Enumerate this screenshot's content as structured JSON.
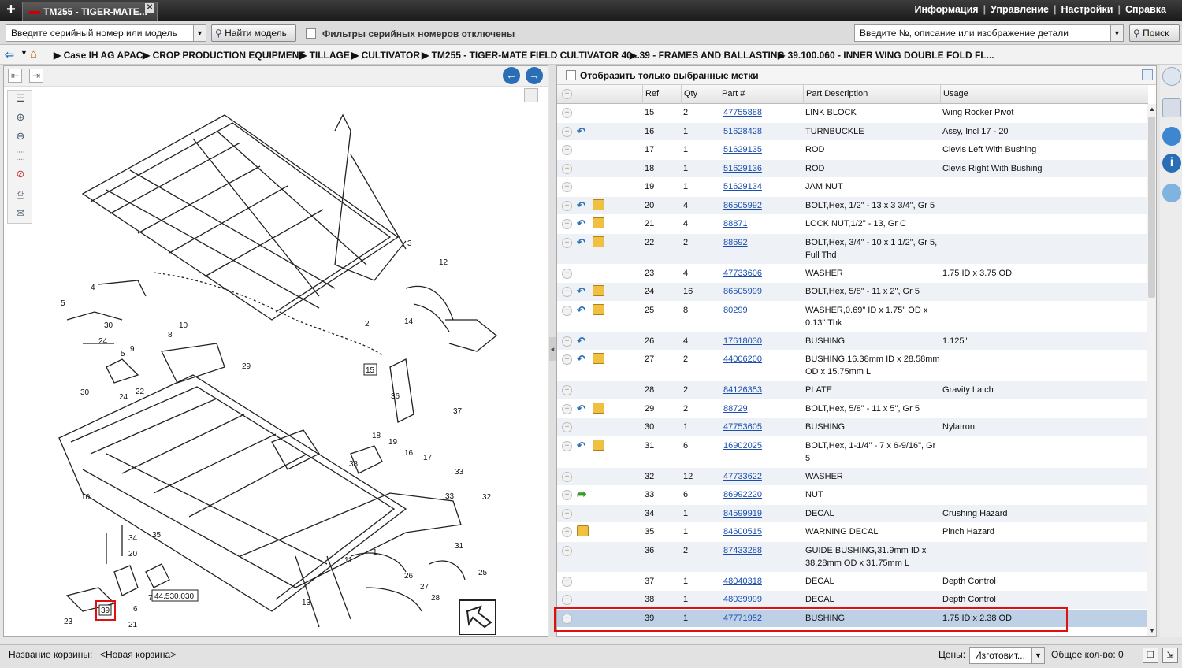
{
  "tab": {
    "title": "TM255 - TIGER-MATE..."
  },
  "top_menu": [
    "Информация",
    "Управление",
    "Настройки",
    "Справка"
  ],
  "toolbar": {
    "serial_placeholder": "Введите серийный номер или модель",
    "find_model_label": "Найти модель",
    "serial_filter_label": "Фильтры серийных номеров отключены",
    "part_search_placeholder": "Введите №, описание или изображение детали",
    "search_label": "Поиск"
  },
  "breadcrumbs": [
    "Case IH AG APAC",
    "CROP PRODUCTION EQUIPMENT",
    "TILLAGE",
    "CULTIVATOR",
    "TM255 - TIGER-MATE FIELD CULTIVATOR 40...",
    "39 - FRAMES AND BALLASTING",
    "39.100.060 - INNER WING DOUBLE FOLD FL..."
  ],
  "diagram": {
    "callouts": [
      "1",
      "2",
      "3",
      "4",
      "5",
      "7",
      "8",
      "9",
      "10",
      "11",
      "12",
      "13",
      "14",
      "15",
      "16",
      "17",
      "18",
      "19",
      "20",
      "21",
      "22",
      "23",
      "24",
      "25",
      "26",
      "27",
      "28",
      "29",
      "30",
      "31",
      "32",
      "33",
      "34",
      "35",
      "36",
      "37",
      "38",
      "39"
    ],
    "selected_callout": "39",
    "image_ref_label": "44.530.030"
  },
  "parts_table": {
    "show_selected_label": "Отобразить только выбранные метки",
    "columns": [
      "Ref",
      "Qty",
      "Part #",
      "Part Description",
      "Usage"
    ],
    "rows": [
      {
        "ref": "15",
        "qty": "2",
        "part": "47755888",
        "desc": "LINK BLOCK",
        "usage": "Wing Rocker Pivot",
        "icons": []
      },
      {
        "ref": "16",
        "qty": "1",
        "part": "51628428",
        "desc": "TURNBUCKLE",
        "usage": "Assy, Incl 17 - 20",
        "icons": [
          "arrow"
        ]
      },
      {
        "ref": "17",
        "qty": "1",
        "part": "51629135",
        "desc": "ROD",
        "usage": "Clevis Left With Bushing",
        "icons": []
      },
      {
        "ref": "18",
        "qty": "1",
        "part": "51629136",
        "desc": "ROD",
        "usage": "Clevis Right With Bushing",
        "icons": []
      },
      {
        "ref": "19",
        "qty": "1",
        "part": "51629134",
        "desc": "JAM NUT",
        "usage": "",
        "icons": []
      },
      {
        "ref": "20",
        "qty": "4",
        "part": "86505992",
        "desc": "BOLT,Hex, 1/2\" - 13 x 3 3/4\", Gr 5",
        "usage": "",
        "icons": [
          "arrow",
          "box"
        ]
      },
      {
        "ref": "21",
        "qty": "4",
        "part": "88871",
        "desc": "LOCK NUT,1/2\" - 13, Gr C",
        "usage": "",
        "icons": [
          "arrow",
          "box"
        ]
      },
      {
        "ref": "22",
        "qty": "2",
        "part": "88692",
        "desc": "BOLT,Hex, 3/4\" - 10 x 1 1/2\", Gr 5,",
        "desc2": "Full Thd",
        "usage": "",
        "icons": [
          "arrow",
          "box"
        ]
      },
      {
        "ref": "23",
        "qty": "4",
        "part": "47733606",
        "desc": "WASHER",
        "usage": "1.75 ID x 3.75 OD",
        "icons": []
      },
      {
        "ref": "24",
        "qty": "16",
        "part": "86505999",
        "desc": "BOLT,Hex, 5/8\" - 11 x 2\", Gr 5",
        "usage": "",
        "icons": [
          "arrow",
          "box"
        ]
      },
      {
        "ref": "25",
        "qty": "8",
        "part": "80299",
        "desc": "WASHER,0.69\" ID x 1.75\" OD x",
        "desc2": "0.13\" Thk",
        "usage": "",
        "icons": [
          "arrow",
          "box"
        ]
      },
      {
        "ref": "26",
        "qty": "4",
        "part": "17618030",
        "desc": "BUSHING",
        "usage": "1.125\"",
        "icons": [
          "arrow"
        ]
      },
      {
        "ref": "27",
        "qty": "2",
        "part": "44006200",
        "desc": "BUSHING,16.38mm ID x 28.58mm",
        "desc2": "OD x 15.75mm L",
        "usage": "",
        "icons": [
          "arrow",
          "box"
        ]
      },
      {
        "ref": "28",
        "qty": "2",
        "part": "84126353",
        "desc": "PLATE",
        "usage": "Gravity Latch",
        "icons": []
      },
      {
        "ref": "29",
        "qty": "2",
        "part": "88729",
        "desc": "BOLT,Hex, 5/8\" - 11 x 5\", Gr 5",
        "usage": "",
        "icons": [
          "arrow",
          "box"
        ]
      },
      {
        "ref": "30",
        "qty": "1",
        "part": "47753605",
        "desc": "BUSHING",
        "usage": "Nylatron",
        "icons": []
      },
      {
        "ref": "31",
        "qty": "6",
        "part": "16902025",
        "desc": "BOLT,Hex, 1-1/4\" - 7 x 6-9/16\", Gr",
        "desc2": "5",
        "usage": "",
        "icons": [
          "arrow",
          "box"
        ]
      },
      {
        "ref": "32",
        "qty": "12",
        "part": "47733622",
        "desc": "WASHER",
        "usage": "",
        "icons": []
      },
      {
        "ref": "33",
        "qty": "6",
        "part": "86992220",
        "desc": "NUT",
        "usage": "",
        "icons": [
          "green"
        ]
      },
      {
        "ref": "34",
        "qty": "1",
        "part": "84599919",
        "desc": "DECAL",
        "usage": "Crushing Hazard",
        "icons": []
      },
      {
        "ref": "35",
        "qty": "1",
        "part": "84600515",
        "desc": "WARNING DECAL",
        "usage": "Pinch Hazard",
        "icons": [
          "boxonly"
        ]
      },
      {
        "ref": "36",
        "qty": "2",
        "part": "87433288",
        "desc": "GUIDE BUSHING,31.9mm ID x",
        "desc2": "38.28mm OD x 31.75mm L",
        "usage": "",
        "icons": []
      },
      {
        "ref": "37",
        "qty": "1",
        "part": "48040318",
        "desc": "DECAL",
        "usage": "Depth Control",
        "icons": []
      },
      {
        "ref": "38",
        "qty": "1",
        "part": "48039999",
        "desc": "DECAL",
        "usage": "Depth Control",
        "icons": []
      },
      {
        "ref": "39",
        "qty": "1",
        "part": "47771952",
        "desc": "BUSHING",
        "usage": "1.75 ID x 2.38 OD",
        "icons": [],
        "selected": true
      }
    ]
  },
  "status_bar": {
    "cart_label": "Название корзины:",
    "cart_value": "<Новая корзина>",
    "prices_label": "Цены:",
    "prices_value": "Изготовит...",
    "total_label": "Общее кол-во: 0"
  },
  "colors": {
    "accent_red": "#e01010",
    "link_blue": "#1a4fb0",
    "selected_row": "#bdd0e6"
  }
}
